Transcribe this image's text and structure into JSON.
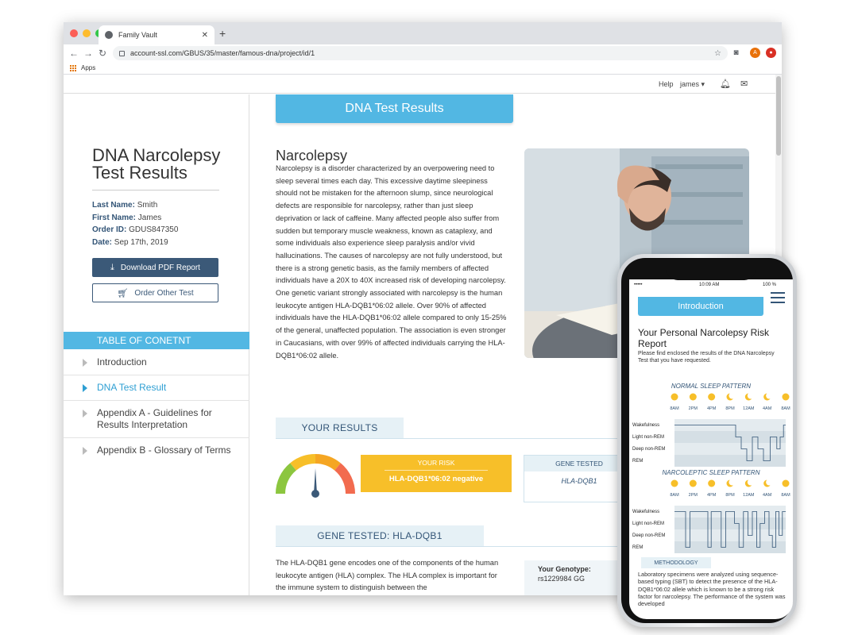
{
  "browser": {
    "tab_title": "Family Vault",
    "url": "account-ssl.com/GBUS/35/master/famous-dna/project/id/1",
    "bookmarks_apps": "Apps",
    "ext_a": "A"
  },
  "topbar": {
    "help": "Help",
    "user": "james ▾"
  },
  "sidebar": {
    "title": "DNA Narcolepsy Test Results",
    "fields": [
      {
        "label": "Last Name:",
        "value": "Smith"
      },
      {
        "label": "First Name:",
        "value": "James"
      },
      {
        "label": "Order ID:",
        "value": "GDUS847350"
      },
      {
        "label": "Date:",
        "value": "Sep 17th, 2019"
      }
    ],
    "download_label": "Download PDF Report",
    "order_label": "Order Other Test",
    "toc_heading": "TABLE OF CONETNT",
    "toc": [
      {
        "label": "Introduction"
      },
      {
        "label": "DNA Test Result"
      },
      {
        "label": "Appendix A - Guidelines for Results Interpretation"
      },
      {
        "label": "Appendix B - Glossary of Terms"
      }
    ]
  },
  "main": {
    "header": "DNA Test Results",
    "article_title": "Narcolepsy",
    "article_body": "Narcolepsy is a disorder characterized by an overpowering need to sleep several times each day. This excessive daytime sleepiness should not be mistaken for the afternoon slump, since neurological defects are responsible for narcolepsy, rather than just sleep deprivation or lack of caffeine. Many affected people also suffer from sudden but temporary muscle weakness, known as cataplexy, and some individuals also experience sleep paralysis and/or vivid hallucinations. The causes of narcolepsy are not fully understood, but there is a strong genetic basis, as the family members of affected individuals have a 20X to 40X increased risk of developing narcolepsy. One genetic variant strongly associated with narcolepsy is the human leukocyte antigen HLA-DQB1*06:02 allele. Over 90% of affected individuals have the HLA-DQB1*06:02 allele compared to only 15-25% of the general, unaffected population. The association is even stronger in Caucasians, with over 99% of affected individuals carrying the HLA-DQB1*06:02 allele.",
    "results_heading": "YOUR RESULTS",
    "risk_label": "YOUR RISK",
    "risk_value": "HLA-DQB1*06:02 negative",
    "gene_tested_label": "GENE TESTED",
    "gene_tested_value": "HLA-DQB1",
    "gene_heading": "GENE TESTED: HLA-DQB1",
    "gene_text": "The HLA-DQB1 gene encodes one of the components of the human leukocyte antigen (HLA) complex. The HLA complex is important for the immune system to distinguish between the",
    "genotype_label": "Your Genotype:",
    "genotype_value": "rs1229984 GG"
  },
  "phone": {
    "carrier": "•••••  ",
    "time": "10:09 AM",
    "battery": "100 %",
    "intro": "Introduction",
    "title": "Your Personal Narcolepsy Risk Report",
    "subtitle": "Please find enclosed the results of the DNA Narcolepsy Test that you have requested.",
    "normal_title": "NORMAL SLEEP PATTERN",
    "narco_title": "NARCOLEPTIC SLEEP PATTERN",
    "time_ticks": [
      "8AM",
      "2PM",
      "4PM",
      "8PM",
      "12AM",
      "4AM",
      "8AM"
    ],
    "stages": [
      "Wakefulness",
      "Light non-REM",
      "Deep non-REM",
      "REM"
    ],
    "methodology_label": "METHODOLOGY",
    "methodology_text": "Laboratory specimens were analyzed using sequence-based typing (SBT) to detect the presence of the HLA-DQB1*06:02 allele which is known to be a strong risk factor for narcolepsy. The performance of the system was developed"
  },
  "colors": {
    "accent": "#52b7e3",
    "navy": "#3b5978",
    "risk": "#f7bf29"
  }
}
